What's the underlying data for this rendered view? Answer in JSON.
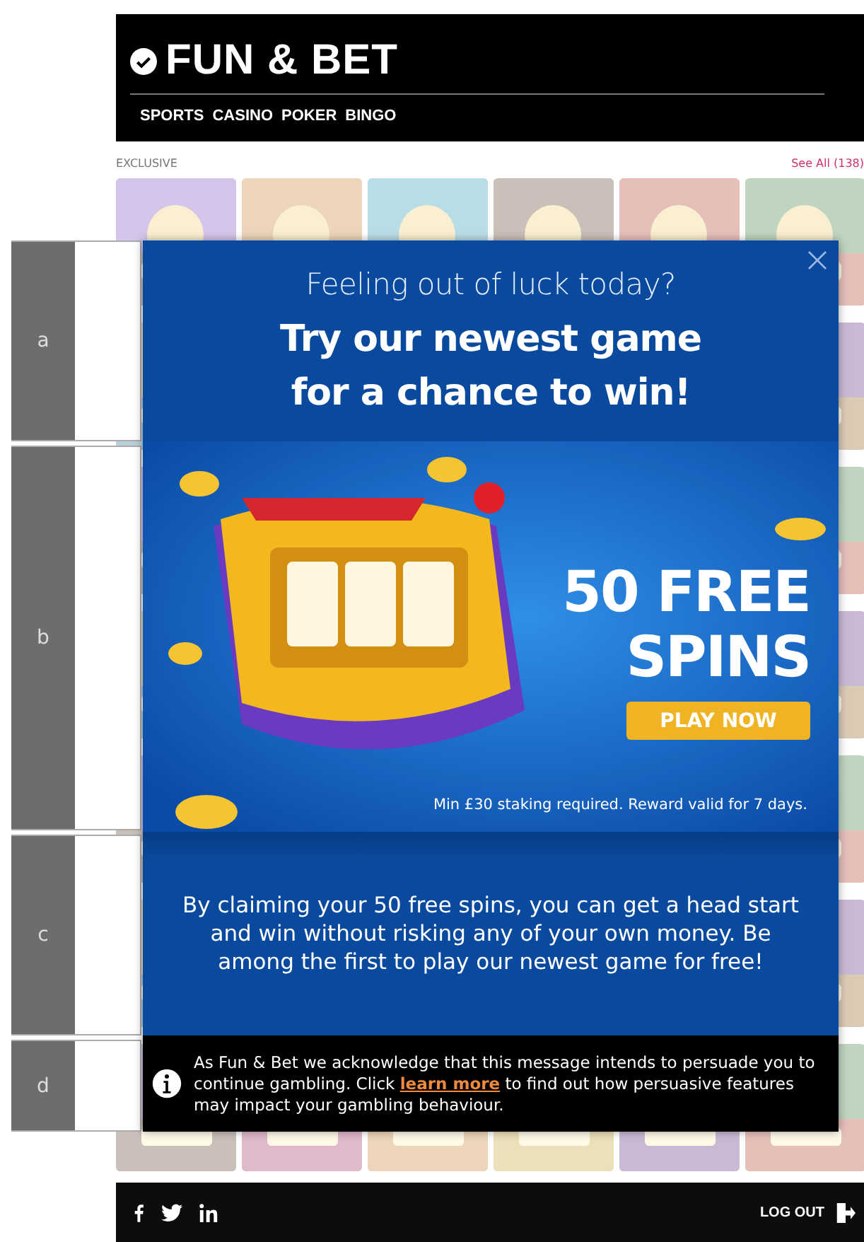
{
  "header": {
    "logo": "FUN & BET",
    "nav": [
      "SPORTS",
      "CASINO",
      "POKER",
      "BINGO"
    ]
  },
  "section": {
    "title": "EXCLUSIVE",
    "link": "See All (138)"
  },
  "annotations": [
    "a",
    "b",
    "c",
    "d"
  ],
  "modal": {
    "kicker": "Feeling out of luck today?",
    "headline": [
      "Try our newest game",
      "for a chance to win!"
    ],
    "banner": {
      "offer": [
        "50 FREE",
        "SPINS"
      ],
      "button": "PLAY NOW",
      "terms": "Min £30 staking required. Reward valid for 7 days."
    },
    "body": "By claiming your 50 free spins, you can get a head start and win without risking any of your own money. Be among the first to play our newest game for free!",
    "notice": {
      "before": "As Fun & Bet we acknowledge that this message intends to persuade you to continue gambling. Click",
      "link": "learn more",
      "after": "to find out how persuasive features may impact your gambling behaviour."
    }
  },
  "footer": {
    "logout": "LOG OUT"
  }
}
